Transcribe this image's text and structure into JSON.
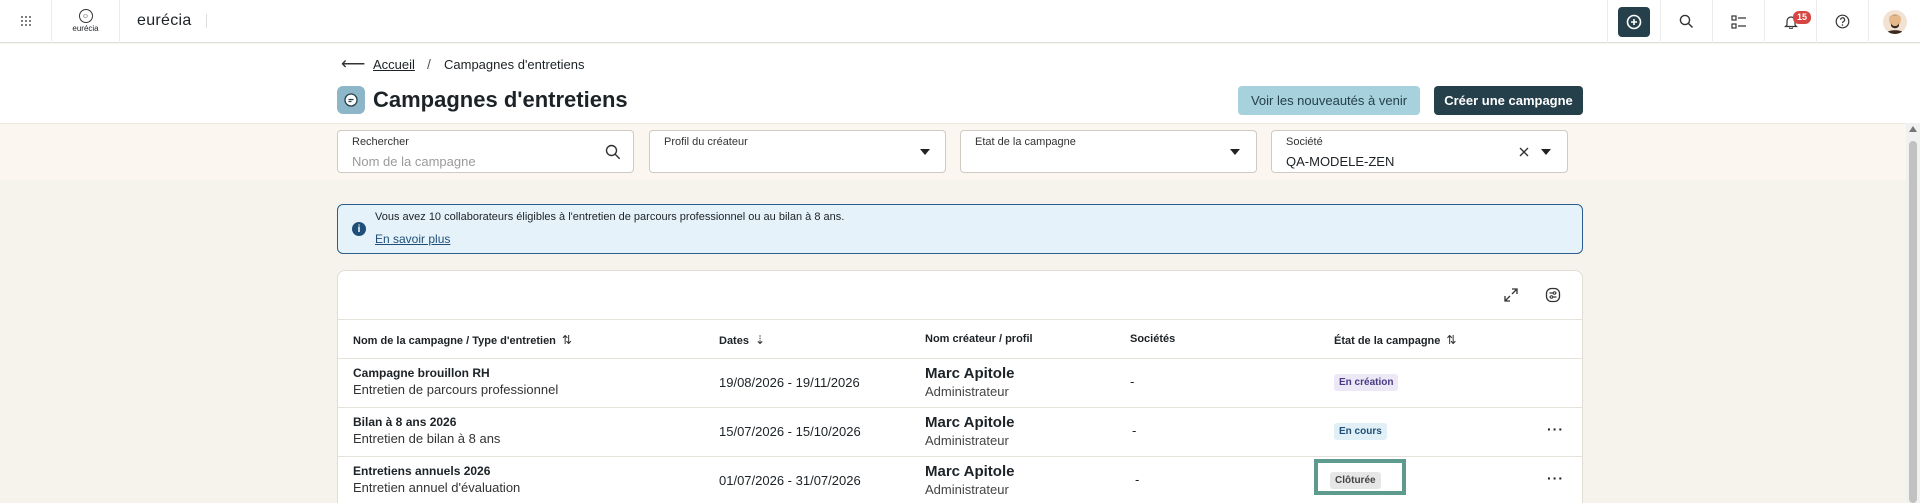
{
  "app": {
    "logo_text": "eurécia",
    "name": "eurécia"
  },
  "topbar": {
    "notification_count": "15"
  },
  "breadcrumb": {
    "home": "Accueil",
    "separator": "/",
    "current": "Campagnes d'entretiens"
  },
  "page": {
    "title": "Campagnes d'entretiens"
  },
  "actions": {
    "news": "Voir les nouveautés à venir",
    "create": "Créer une campagne"
  },
  "filters": {
    "search": {
      "label": "Rechercher",
      "placeholder": "Nom de la campagne"
    },
    "creator_profile": {
      "label": "Profil du créateur"
    },
    "campaign_state": {
      "label": "Etat de la campagne"
    },
    "company": {
      "label": "Société",
      "value": "QA-MODELE-ZEN"
    }
  },
  "info": {
    "text": "Vous avez 10 collaborateurs éligibles à l'entretien de parcours professionnel ou au bilan à 8 ans.",
    "link": "En savoir plus"
  },
  "table": {
    "columns": {
      "name": "Nom de la campagne / Type d'entretien",
      "dates": "Dates",
      "creator": "Nom créateur / profil",
      "companies": "Sociétés",
      "state": "État de la campagne"
    },
    "rows": [
      {
        "name": "Campagne brouillon RH",
        "type": "Entretien de parcours professionnel",
        "dates": "19/08/2026 - 19/11/2026",
        "creator": "Marc Apitole",
        "profile": "Administrateur",
        "companies": "-",
        "state": "En création"
      },
      {
        "name": "Bilan à 8 ans 2026",
        "type": "Entretien de bilan à 8 ans",
        "dates": "15/07/2026 - 15/10/2026",
        "creator": "Marc Apitole",
        "profile": "Administrateur",
        "companies": "-",
        "state": "En cours"
      },
      {
        "name": "Entretiens annuels 2026",
        "type": "Entretien annuel d'évaluation",
        "dates": "01/07/2026 - 31/07/2026",
        "creator": "Marc Apitole",
        "profile": "Administrateur",
        "companies": "-",
        "state": "Clôturée"
      }
    ],
    "more_label": "···"
  },
  "colors": {
    "primary": "#25404a",
    "accent_light": "#a7d1dc",
    "badge_red": "#d64541",
    "info_bg": "#e5f2f9",
    "state_creation_bg": "#ece8f6",
    "state_creation_fg": "#4a3a86",
    "state_progress_bg": "#e0f0f6",
    "state_progress_fg": "#1f4f78",
    "state_closed_bg": "#e6e6e6",
    "state_closed_fg": "#444444",
    "focus_outline": "#5f9a8e"
  }
}
